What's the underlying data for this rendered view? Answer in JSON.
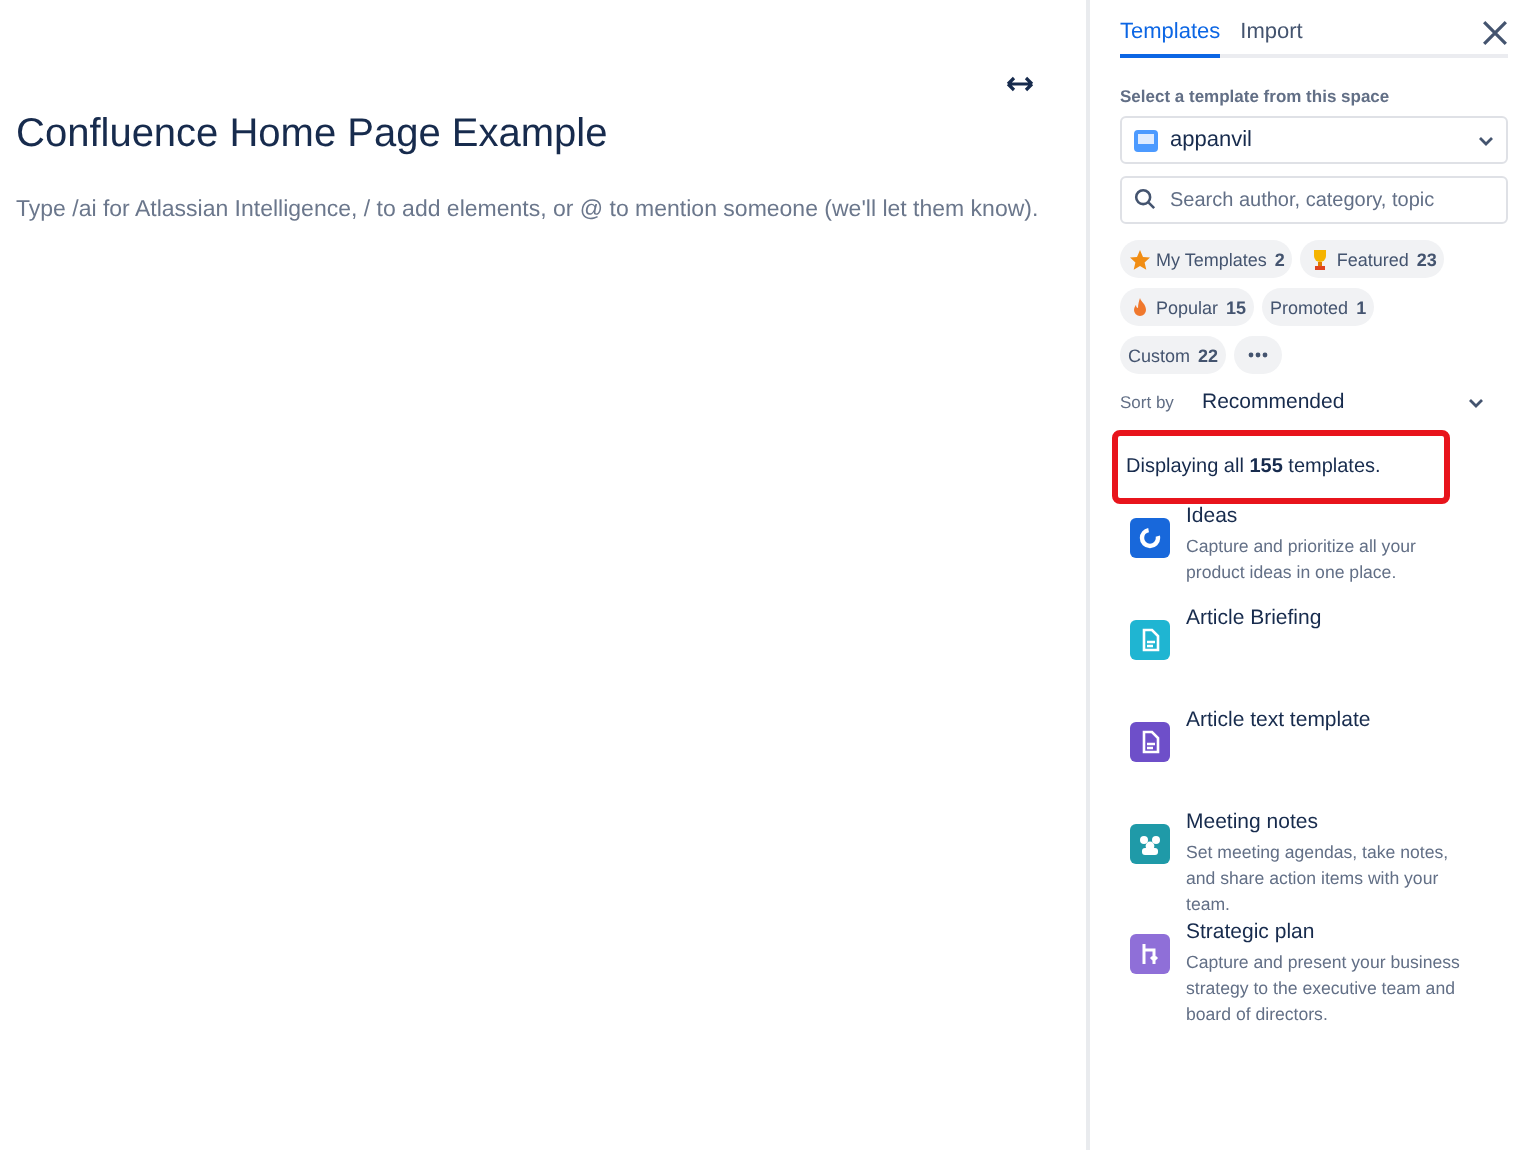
{
  "editor": {
    "title": "Confluence Home Page Example",
    "placeholder": "Type /ai for Atlassian Intelligence, / to add elements, or @ to mention someone (we'll let them know)."
  },
  "panel": {
    "tabs": [
      {
        "label": "Templates",
        "selected": true
      },
      {
        "label": "Import",
        "selected": false
      }
    ],
    "space_label": "Select a template from this space",
    "space": "appanvil",
    "search": {
      "placeholder": "Search author, category, topic"
    },
    "filters": [
      {
        "kind": "star",
        "label": "My Templates",
        "count": "2"
      },
      {
        "kind": "trophy",
        "label": "Featured",
        "count": "23"
      },
      {
        "kind": "fire",
        "label": "Popular",
        "count": "15"
      },
      {
        "kind": "plain",
        "label": "Promoted",
        "count": "1"
      },
      {
        "kind": "plain",
        "label": "Custom",
        "count": "22"
      },
      {
        "kind": "more"
      }
    ],
    "sort_label": "Sort by",
    "sort": "Recommended",
    "summary": {
      "text": "Displaying all **155** templates.",
      "highlighted": true
    },
    "templates": [
      {
        "kind": "bulb",
        "color": "#1868db",
        "name": "Ideas",
        "description": "Capture and prioritize all your product ideas in one place."
      },
      {
        "kind": "doc",
        "color": "#1fb5d2",
        "name": "Article Briefing"
      },
      {
        "kind": "doc",
        "color": "#6e4fc9",
        "name": "Article text template"
      },
      {
        "kind": "people",
        "color": "#1f9aa8",
        "name": "Meeting notes",
        "description": "Set meeting agendas, take notes, and share action items with your team."
      },
      {
        "kind": "flow",
        "color": "#8f6fd8",
        "name": "Strategic plan",
        "description": "Capture and present your business strategy to the executive team and board of directors."
      }
    ]
  }
}
